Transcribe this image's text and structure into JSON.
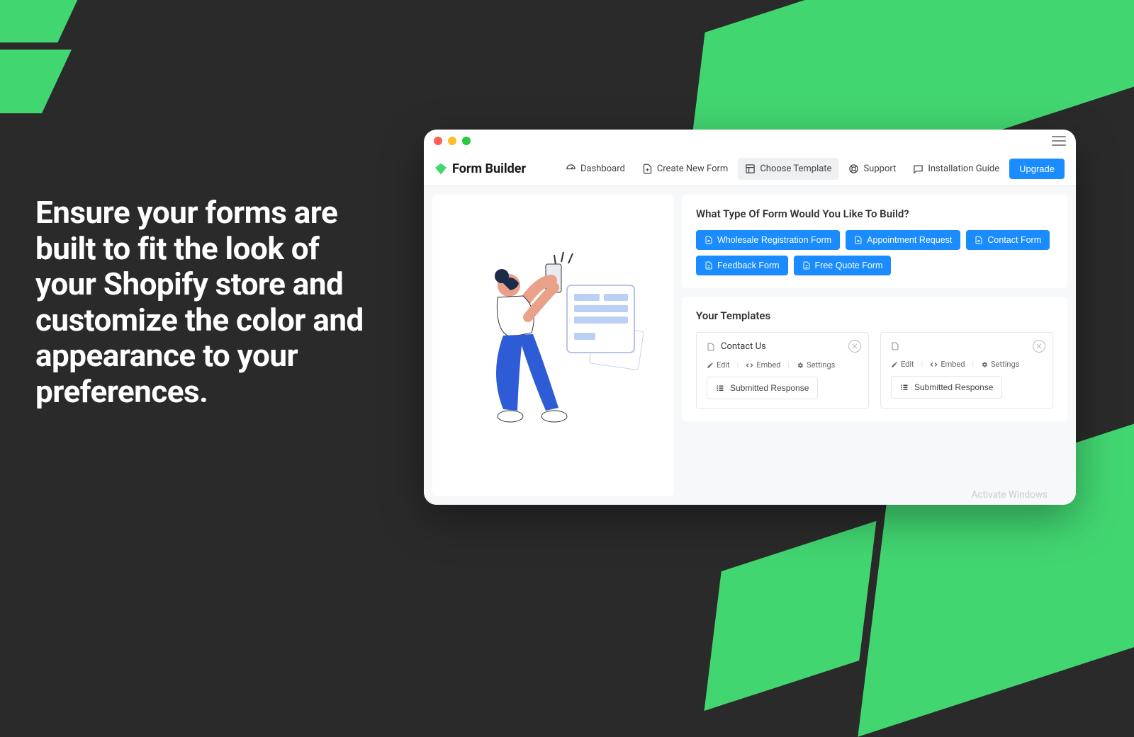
{
  "headline": "Ensure your forms are built to fit the look of your Shopify store and customize the color and appearance to your preferences.",
  "brand": "Form Builder",
  "nav": {
    "dashboard": "Dashboard",
    "create": "Create New Form",
    "choose": "Choose Template",
    "support": "Support",
    "install": "Installation Guide",
    "upgrade": "Upgrade"
  },
  "formtype": {
    "heading": "What Type Of Form Would You Like To Build?",
    "options": [
      "Wholesale Registration Form",
      "Appointment Request",
      "Contact Form",
      "Feedback Form",
      "Free Quote Form"
    ]
  },
  "templates": {
    "heading": "Your Templates",
    "cards": [
      {
        "title": "Contact Us",
        "edit": "Edit",
        "embed": "Embed",
        "settings": "Settings",
        "response": "Submitted Response"
      },
      {
        "title": "",
        "edit": "Edit",
        "embed": "Embed",
        "settings": "Settings",
        "response": "Submitted Response"
      }
    ]
  },
  "ghost": "Activate Windows"
}
